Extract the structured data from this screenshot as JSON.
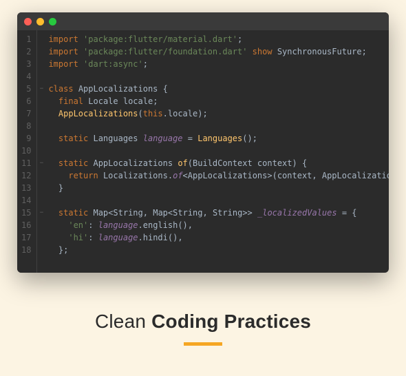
{
  "caption": {
    "light": "Clean ",
    "bold": "Coding Practices"
  },
  "code": {
    "lines": [
      {
        "n": 1,
        "fold": "",
        "tokens": [
          [
            "kw",
            "import "
          ],
          [
            "str",
            "'package:flutter/material.dart'"
          ],
          [
            "",
            ";"
          ]
        ]
      },
      {
        "n": 2,
        "fold": "",
        "tokens": [
          [
            "kw",
            "import "
          ],
          [
            "str",
            "'package:flutter/foundation.dart'"
          ],
          [
            "kw",
            " show "
          ],
          [
            "cls",
            "SynchronousFuture"
          ],
          [
            "",
            ";"
          ]
        ]
      },
      {
        "n": 3,
        "fold": "",
        "tokens": [
          [
            "kw",
            "import "
          ],
          [
            "str",
            "'dart:async'"
          ],
          [
            "",
            ";"
          ]
        ]
      },
      {
        "n": 4,
        "fold": "",
        "tokens": []
      },
      {
        "n": 5,
        "fold": "−",
        "tokens": [
          [
            "kw",
            "class "
          ],
          [
            "cls",
            "AppLocalizations"
          ],
          [
            "",
            " {"
          ]
        ]
      },
      {
        "n": 6,
        "fold": "",
        "tokens": [
          [
            "",
            "  "
          ],
          [
            "kw",
            "final "
          ],
          [
            "type",
            "Locale "
          ],
          [
            "param",
            "locale"
          ],
          [
            "",
            ";"
          ]
        ]
      },
      {
        "n": 7,
        "fold": "",
        "tokens": [
          [
            "",
            "  "
          ],
          [
            "fn",
            "AppLocalizations"
          ],
          [
            "",
            "("
          ],
          [
            "this",
            "this"
          ],
          [
            "",
            ".locale);"
          ]
        ]
      },
      {
        "n": 8,
        "fold": "",
        "tokens": []
      },
      {
        "n": 9,
        "fold": "",
        "tokens": [
          [
            "",
            "  "
          ],
          [
            "kw",
            "static "
          ],
          [
            "type",
            "Languages "
          ],
          [
            "it",
            "language"
          ],
          [
            "",
            " = "
          ],
          [
            "fn",
            "Languages"
          ],
          [
            "",
            "();"
          ]
        ]
      },
      {
        "n": 10,
        "fold": "",
        "tokens": []
      },
      {
        "n": 11,
        "fold": "−",
        "tokens": [
          [
            "",
            "  "
          ],
          [
            "kw",
            "static "
          ],
          [
            "type",
            "AppLocalizations "
          ],
          [
            "fn",
            "of"
          ],
          [
            "",
            "("
          ],
          [
            "type",
            "BuildContext "
          ],
          [
            "param",
            "context"
          ],
          [
            "",
            ") {"
          ]
        ]
      },
      {
        "n": 12,
        "fold": "",
        "tokens": [
          [
            "",
            "    "
          ],
          [
            "kw",
            "return "
          ],
          [
            "cls",
            "Localizations"
          ],
          [
            "",
            "."
          ],
          [
            "it",
            "of"
          ],
          [
            "",
            "<"
          ],
          [
            "type",
            "AppLocalizations"
          ],
          [
            "",
            ">(context, AppLocalizations);"
          ]
        ]
      },
      {
        "n": 13,
        "fold": "",
        "tokens": [
          [
            "",
            "  }"
          ]
        ]
      },
      {
        "n": 14,
        "fold": "",
        "tokens": []
      },
      {
        "n": 15,
        "fold": "−",
        "tokens": [
          [
            "",
            "  "
          ],
          [
            "kw",
            "static "
          ],
          [
            "type",
            "Map"
          ],
          [
            "",
            "<"
          ],
          [
            "type",
            "String"
          ],
          [
            "",
            ", "
          ],
          [
            "type",
            "Map"
          ],
          [
            "",
            "<"
          ],
          [
            "type",
            "String"
          ],
          [
            "",
            ", "
          ],
          [
            "type",
            "String"
          ],
          [
            "",
            ">> "
          ],
          [
            "it",
            "_localizedValues"
          ],
          [
            "",
            " = {"
          ]
        ]
      },
      {
        "n": 16,
        "fold": "",
        "tokens": [
          [
            "",
            "    "
          ],
          [
            "str",
            "'en'"
          ],
          [
            "",
            ": "
          ],
          [
            "it",
            "language"
          ],
          [
            "",
            ".english(),"
          ]
        ]
      },
      {
        "n": 17,
        "fold": "",
        "tokens": [
          [
            "",
            "    "
          ],
          [
            "str",
            "'hi'"
          ],
          [
            "",
            ": "
          ],
          [
            "it",
            "language"
          ],
          [
            "",
            ".hindi(),"
          ]
        ]
      },
      {
        "n": 18,
        "fold": "",
        "tokens": [
          [
            "",
            "  };"
          ]
        ]
      }
    ]
  }
}
